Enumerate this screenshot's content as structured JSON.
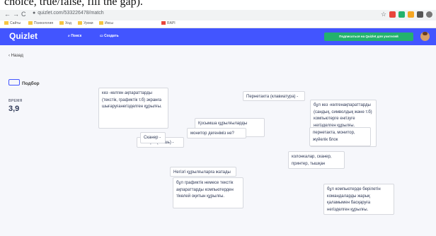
{
  "caption": "choice, true/false, fill the gap).",
  "browser": {
    "back": "←",
    "forward": "→",
    "reload": "C",
    "url": "quizlet.com/533226478/match",
    "bookmarks": [
      "Сайты",
      "Психология",
      "Ход",
      "Уроки",
      "Иксы",
      "RAPI"
    ]
  },
  "app": {
    "logo": "Quizlet",
    "nav": {
      "search": "Поиск",
      "create": "Создать"
    },
    "teacher_button": "Подписаться на Quizlet для учителей",
    "accent": "#4255ff",
    "cta_color": "#23b26d"
  },
  "sidebar": {
    "back": "Назад",
    "mode": "Подбор",
    "time_label": "ВРЕМЯ",
    "time_value": "3,9"
  },
  "cards": [
    {
      "text": "кез -келген ақпараттарды (текстік, графиктік т.б) экранға шығаруғанегізделген құрылғы."
    },
    {
      "text": "Қосымша құрылғыларды көрсет"
    },
    {
      "text": "Тышқан (мышь) -"
    },
    {
      "text": "Сканер -"
    },
    {
      "text": "монитор дегеніміз не?"
    },
    {
      "text": "Пернетакта (клавиатура) -"
    },
    {
      "text": "бұл кез -келгенақпараттарды (сандық, символдық және т.б) компьютерге енгізуге негізделген құрылғы."
    },
    {
      "text": "пернетакта, монитор, жүйелік блок"
    },
    {
      "text": "колонкалар, сканер, принтер, тышқан"
    },
    {
      "text": "Негізгі құрылғыларға жатады"
    },
    {
      "text": "бұл графиктік немесе текстік ақпараттарды компьютерден тікелей оқитын құрылғы."
    },
    {
      "text": "бұл компьютерде берілетін командаларды жарық қаламымен басқаруға негізделген құрылғы."
    }
  ]
}
